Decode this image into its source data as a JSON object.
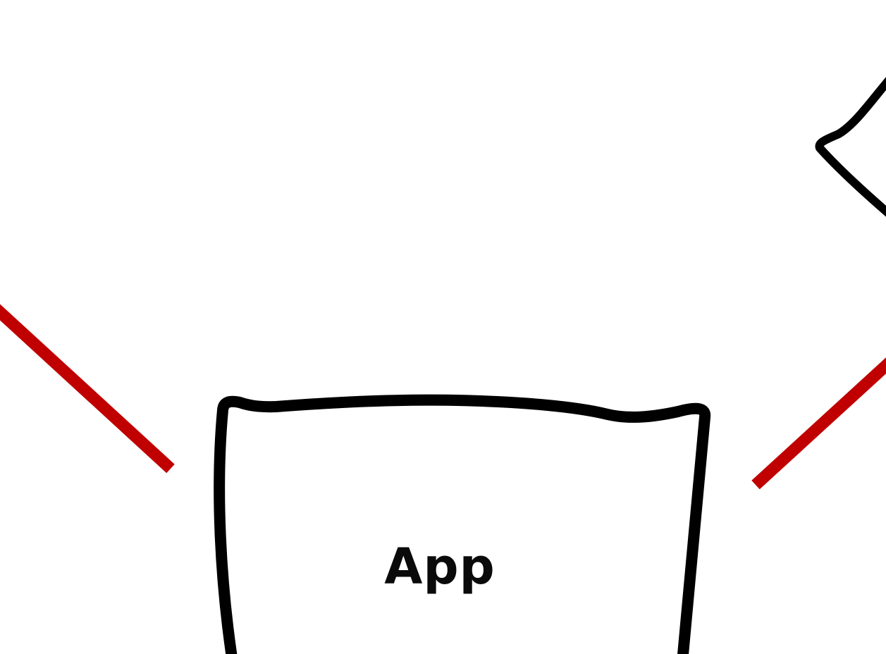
{
  "diagram": {
    "nodes": [
      {
        "id": "app",
        "label": "App",
        "shape": "hand-drawn-rectangle"
      },
      {
        "id": "right-diamond",
        "label": "",
        "shape": "hand-drawn-diamond"
      }
    ],
    "connectors": [
      {
        "id": "left-connector",
        "color": "#c00000"
      },
      {
        "id": "right-connector",
        "color": "#c00000"
      }
    ],
    "colors": {
      "background": "#ffffff",
      "stroke": "#000000",
      "connector": "#c00000"
    }
  }
}
